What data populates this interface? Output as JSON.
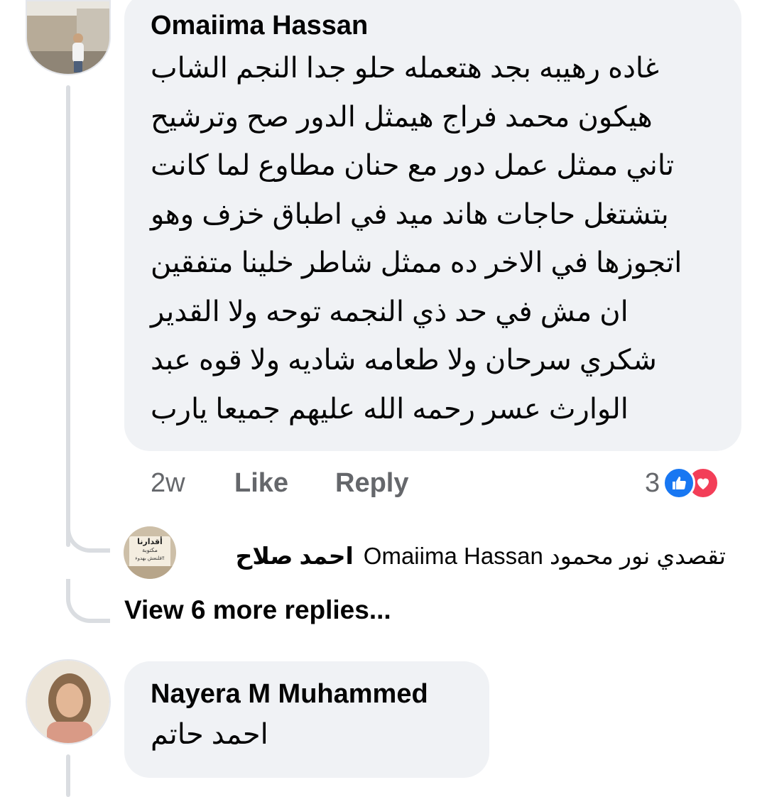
{
  "comment1": {
    "author": "Omaiima Hassan",
    "text": "غاده رهيبه بجد هتعمله حلو جدا النجم الشاب\nهيكون محمد فراج هيمثل الدور صح وترشيح\nتاني ممثل عمل دور مع حنان مطاوع لما كانت\nبتشتغل حاجات هاند ميد في اطباق خزف وهو\nاتجوزها في الاخر ده ممثل شاطر خلينا متفقين\nان مش في حد ذي  النجمه توحه ولا القدير\nشكري سرحان ولا طعامه شاديه ولا قوه عبد\nالوارث عسر رحمه الله عليهم جميعا يارب",
    "time": "2w",
    "like_label": "Like",
    "reply_label": "Reply",
    "reaction_count": "3",
    "reaction_icons": [
      "like-icon",
      "love-icon"
    ]
  },
  "reply1": {
    "author": "احمد صلاح",
    "text": "تقصدي نور محمود Omaiima Hassan",
    "avatar_text": [
      "أقدارنا",
      "مكتوبة",
      "فلنعش بهدوء!!"
    ]
  },
  "view_more_label": "View 6 more replies...",
  "comment2": {
    "author": "Nayera M Muhammed",
    "text": "احمد حاتم"
  },
  "colors": {
    "bubble": "#f0f2f5",
    "meta": "#65676b",
    "like": "#1877f2",
    "love": "#f33e58"
  }
}
